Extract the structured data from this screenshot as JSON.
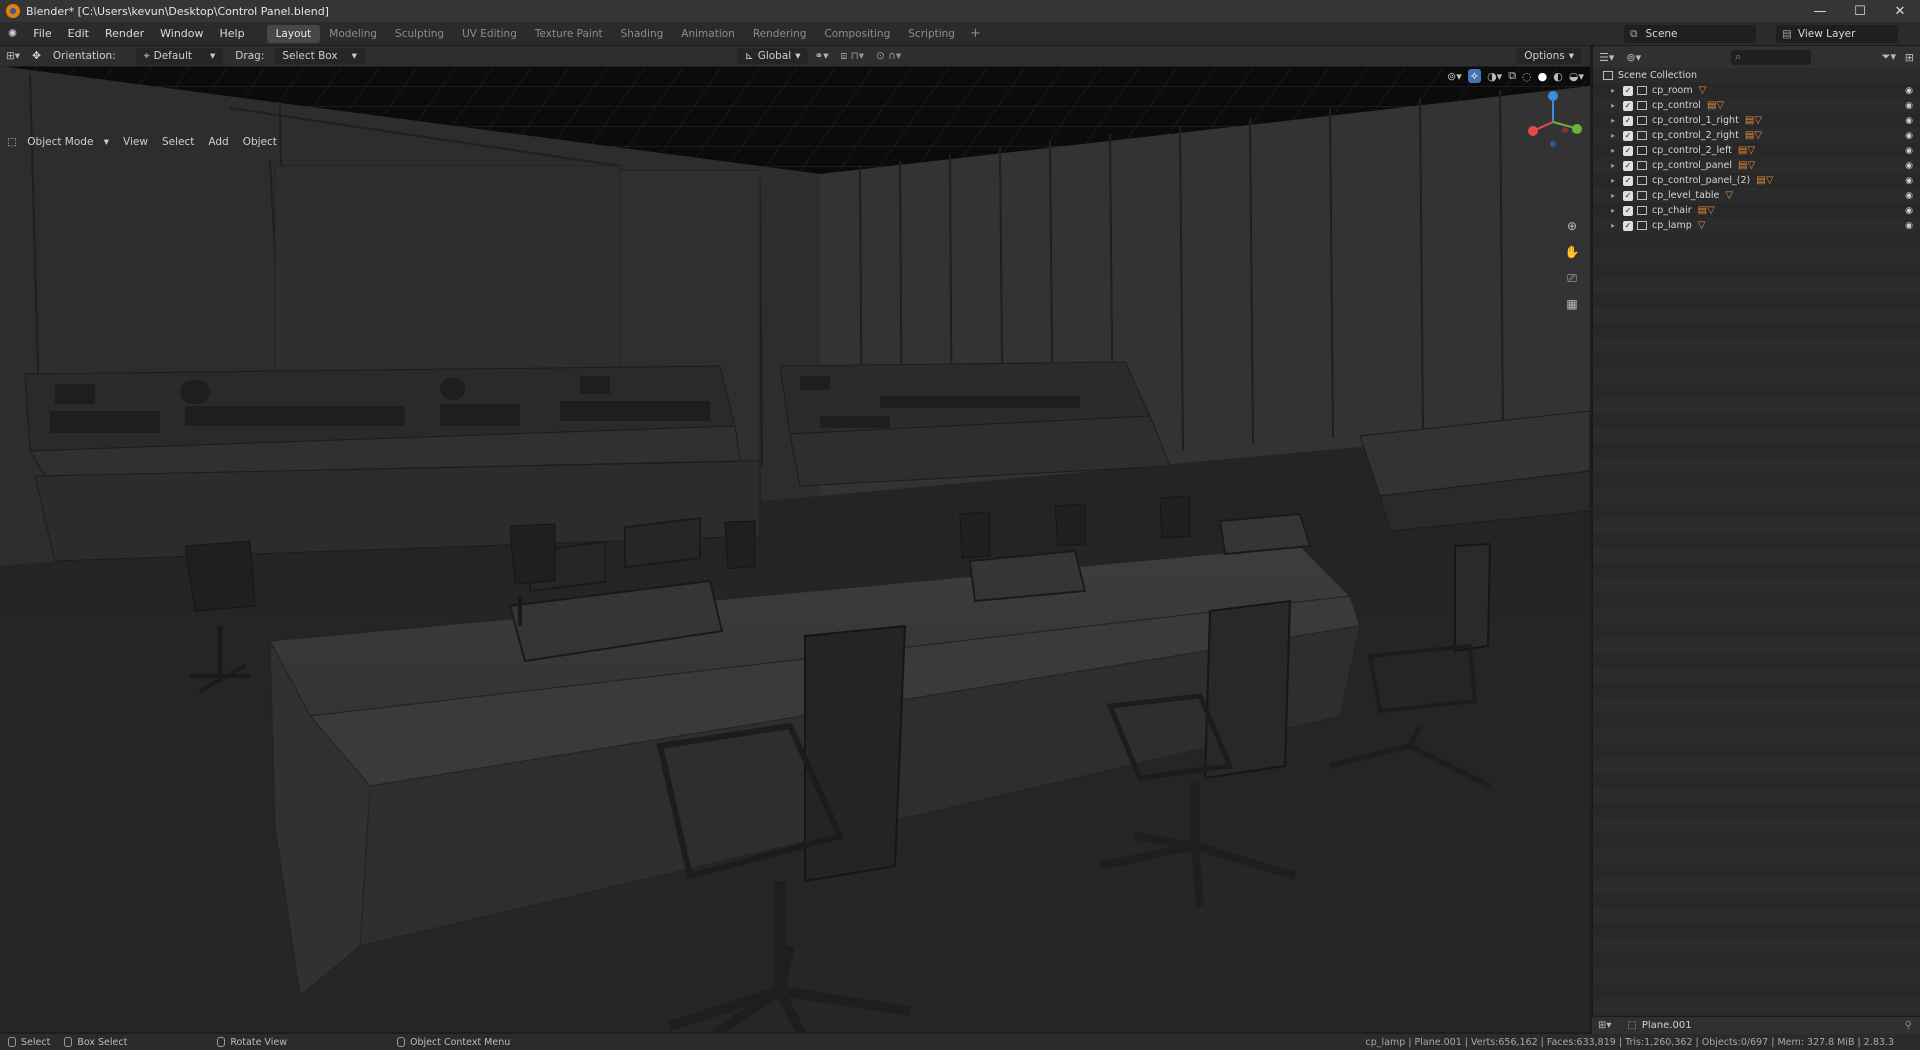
{
  "window": {
    "title": "Blender* [C:\\Users\\kevun\\Desktop\\Control Panel.blend]",
    "controls": [
      "—",
      "☐",
      "✕"
    ]
  },
  "menu": {
    "items": [
      "File",
      "Edit",
      "Render",
      "Window",
      "Help"
    ]
  },
  "workspaces": {
    "tabs": [
      "Layout",
      "Modeling",
      "Sculpting",
      "UV Editing",
      "Texture Paint",
      "Shading",
      "Animation",
      "Rendering",
      "Compositing",
      "Scripting"
    ],
    "active": "Layout",
    "add": "+"
  },
  "scene": {
    "name": "Scene",
    "view_layer": "View Layer"
  },
  "viewport_header": {
    "orientation_label": "Orientation:",
    "orientation_value": "Default",
    "drag_label": "Drag:",
    "drag_value": "Select Box",
    "transform": "Global",
    "options": "Options"
  },
  "viewport_sub": {
    "mode": "Object Mode",
    "items": [
      "View",
      "Select",
      "Add",
      "Object"
    ]
  },
  "outliner": {
    "root": "Scene Collection",
    "items": [
      {
        "name": "cp_room"
      },
      {
        "name": "cp_control"
      },
      {
        "name": "cp_control_1_right"
      },
      {
        "name": "cp_control_2_right"
      },
      {
        "name": "cp_control_2_left"
      },
      {
        "name": "cp_control_panel"
      },
      {
        "name": "cp_control_panel_(2)"
      },
      {
        "name": "cp_level_table"
      },
      {
        "name": "cp_chair"
      },
      {
        "name": "cp_lamp"
      }
    ]
  },
  "properties": {
    "object": "Plane.001"
  },
  "statusbar": {
    "select": "Select",
    "box_select": "Box Select",
    "rotate": "Rotate View",
    "context": "Object Context Menu",
    "stats": "cp_lamp | Plane.001 | Verts:656,162 | Faces:633,819 | Tris:1,260,362 | Objects:0/697 | Mem: 327.8 MiB | 2.83.3"
  },
  "colors": {
    "accent": "#e87d0d",
    "active_tab": "#474747",
    "gizmo_x": "#e64a4a",
    "gizmo_y": "#6bb13e",
    "gizmo_z": "#3a8de0"
  }
}
